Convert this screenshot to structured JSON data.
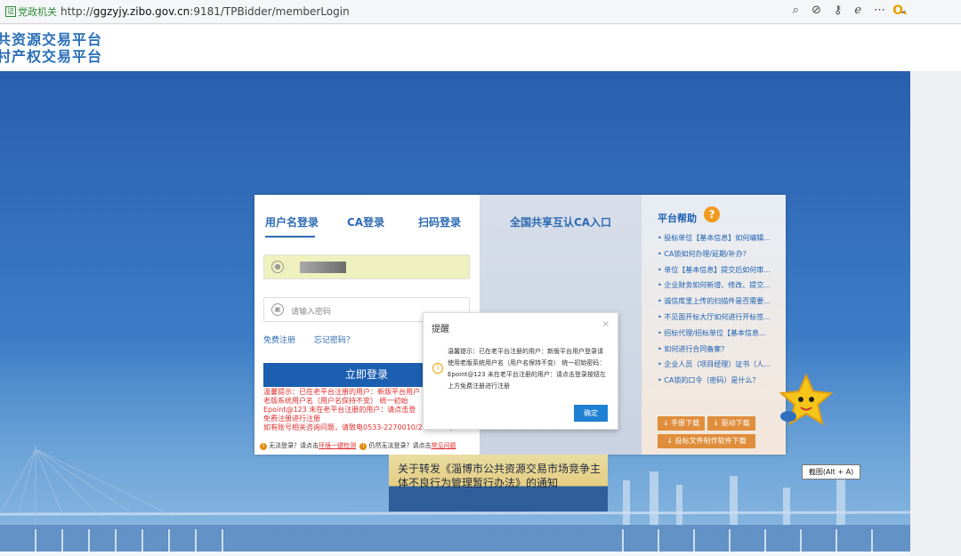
{
  "browser": {
    "gov_badge": "党政机关",
    "gov_badge_icon": "证",
    "url_prefix": "http://",
    "url_host": "ggzyjy.zibo.gov.cn",
    "url_rest": ":9181/TPBidder/memberLogin",
    "icons": [
      "zoom-icon",
      "block-icon",
      "key-icon",
      "ie-icon",
      "more-icon",
      "chevron-icon"
    ],
    "ext_label": "O."
  },
  "header": {
    "line1": "共资源交易平台",
    "line2": "村产权交易平台"
  },
  "login": {
    "tabs": [
      "用户名登录",
      "CA登录",
      "扫码登录"
    ],
    "password_placeholder": "请输入密码",
    "register_link": "免费注册",
    "forgot_link": "忘记密码？",
    "login_button": "立即登录",
    "notice_lines": [
      "温馨提示：已在老平台注册的用户：新版平台用户",
      "老版系统用户名（用户名保持不变） 统一初始",
      "Epoint@123 未在老平台注册的用户：请点击登",
      "免费注册进行注册",
      "如有账号相关咨询问题，请致电0533-2270010/2270020。"
    ],
    "footer": {
      "part1": "无法登录？请点击",
      "link1": "环境一键检测",
      "part2": "仍然无法登录？请点击",
      "link2": "常见问题"
    }
  },
  "ca_entry": "全国共享互认CA入口",
  "help": {
    "title": "平台帮助",
    "items": [
      "投标单位【基本信息】如何编辑...",
      "CA锁如何办理/延期/补办？",
      "单位【基本信息】提交后如何审...",
      "企业财务如何新增、修改、提交...",
      "诚信库里上传的扫描件是否需要...",
      "不见面开标大厅如何进行开标签...",
      "招标代理/招标单位【基本信息...",
      "如何进行合同备案？",
      "企业人员（项目经理）证书（人...",
      "CA锁的口令（密码）是什么？"
    ],
    "manual_button": "手册下载",
    "driver_button": "驱动下载",
    "verify_button": "投标文件制作软件下载"
  },
  "news": {
    "text": "关于转发《淄博市公共资源交易市场竞争主体不良行为管理暂行办法》的通知"
  },
  "modal": {
    "title": "提醒",
    "close": "×",
    "body": "温馨提示：已在老平台注册的用户：新版平台用户登录请使用老版系统用户名（用户名保持不变） 统一初始密码：Epoint@123 未在老平台注册的用户：请点击登录按钮左上方免费注册进行注册",
    "ok": "确定"
  },
  "tooltip": "截图(Alt + A)",
  "colors": {
    "accent": "#1c5fb1",
    "warn": "#e12d2d",
    "download": "#e08e3c"
  }
}
